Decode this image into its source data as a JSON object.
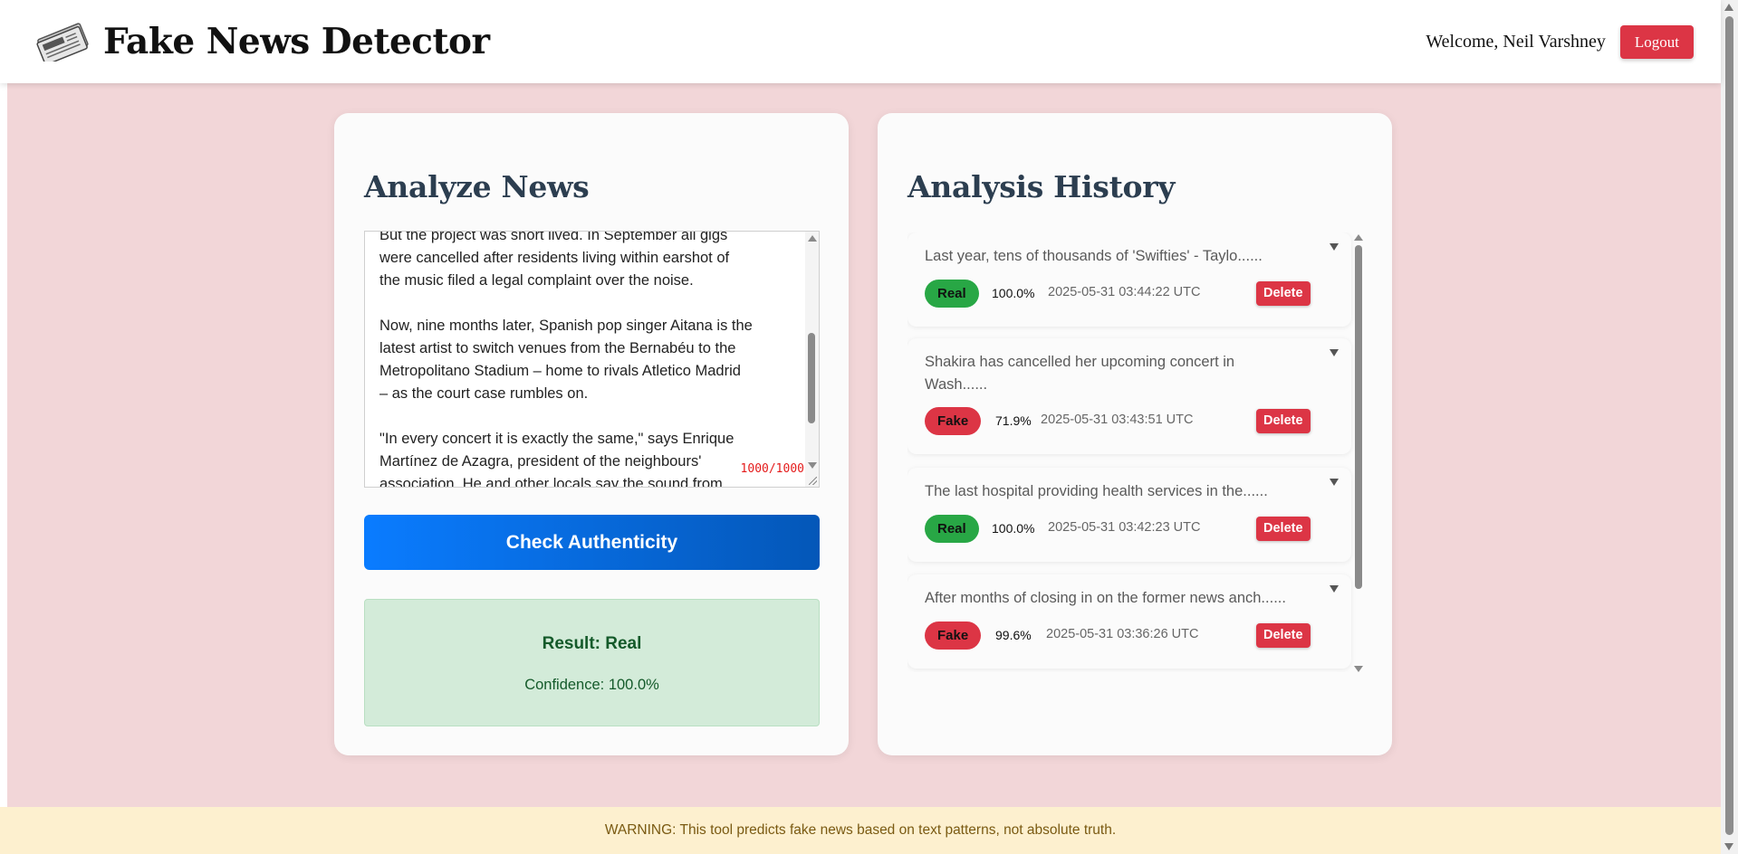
{
  "header": {
    "brand_icon": "newspaper-icon",
    "title": "Fake News Detector",
    "welcome": "Welcome, Neil Varshney",
    "logout_label": "Logout"
  },
  "analyze": {
    "title": "Analyze News",
    "text": "But the project was short lived. In September all gigs\nwere cancelled after residents living within earshot of\nthe music filed a legal complaint over the noise.\n\nNow, nine months later, Spanish pop singer Aitana is the\nlatest artist to switch venues from the Bernabéu to the\nMetropolitano Stadium – home to rivals Atletico Madrid\n– as the court case rumbles on.\n\n\"In every concert it is exactly the same,\" says Enrique\nMartínez de Azagra, president of the neighbours'\nassociation. He and other locals say the sound from",
    "char_count": "1000/1000",
    "check_label": "Check Authenticity",
    "result_label": "Result: Real",
    "confidence_label": "Confidence: 100.0%"
  },
  "history": {
    "title": "Analysis History",
    "delete_label": "Delete",
    "items": [
      {
        "text": "Last year, tens of thousands of 'Swifties' - Taylo......",
        "verdict": "Real",
        "confidence": "100.0%",
        "time": "2025-05-31 03:44:22 UTC"
      },
      {
        "text": "Shakira has cancelled her upcoming concert in Wash......",
        "verdict": "Fake",
        "confidence": "71.9%",
        "time": "2025-05-31 03:43:51 UTC"
      },
      {
        "text": "The last hospital providing health services in the......",
        "verdict": "Real",
        "confidence": "100.0%",
        "time": "2025-05-31 03:42:23 UTC"
      },
      {
        "text": "After months of closing in on the former news anch......",
        "verdict": "Fake",
        "confidence": "99.6%",
        "time": "2025-05-31 03:36:26 UTC"
      }
    ]
  },
  "footer": {
    "warning": "WARNING: This tool predicts fake news based on text patterns, not absolute truth."
  },
  "colors": {
    "background": "#f2d6d8",
    "real": "#28a745",
    "fake": "#dc3545",
    "primary": "#0a7cff"
  }
}
